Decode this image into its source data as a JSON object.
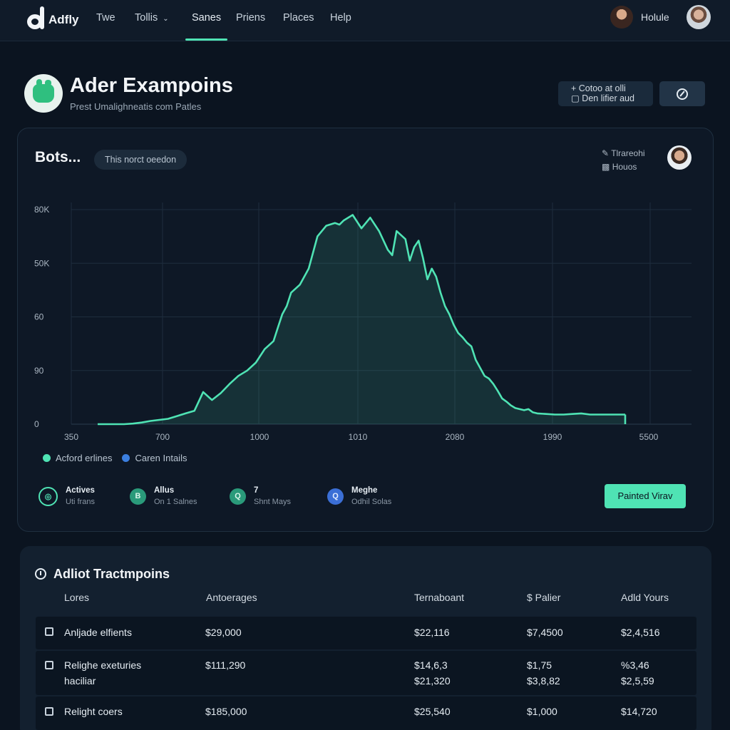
{
  "app": {
    "logo_text": "Adfly",
    "nav": [
      "Twe",
      "Tollis",
      "Sanes",
      "Priens",
      "Places",
      "Help"
    ],
    "user_name": "Holule"
  },
  "header": {
    "title": "Ader Exampoins",
    "subtitle": "Prest Umalighneatis com Patles",
    "stack_button": {
      "line1": "+ Cotoo at olli",
      "line2": "Den lifier aud"
    }
  },
  "chart_card": {
    "title": "Bots...",
    "chip": "This norct oeedon",
    "meta": [
      "Tlrareohi",
      "Houos"
    ],
    "legend": [
      {
        "label": "Acford erlines",
        "color": "#4fe3b4"
      },
      {
        "label": "Caren Intails",
        "color": "#3b7fe0"
      }
    ],
    "stats": [
      {
        "label": "Actives",
        "sub": "Uti frans",
        "icon": "◎",
        "color": "#4fe3b4"
      },
      {
        "label": "Allus",
        "sub": "On 1 Salnes",
        "icon": "B",
        "color": "#2a9a7a"
      },
      {
        "label": "7",
        "sub": "Shnt Mays",
        "icon": "Q",
        "color": "#2a9a7a"
      },
      {
        "label": "Meghe",
        "sub": "Odhil Solas",
        "icon": "Q",
        "color": "#3b6fd6"
      }
    ],
    "primary_button": "Painted Virav"
  },
  "chart_data": {
    "type": "area",
    "x_ticks": [
      "350",
      "700",
      "1000",
      "1010",
      "2080",
      "1990",
      "5500"
    ],
    "y_ticks": [
      "0",
      "90",
      "60",
      "50K",
      "80K"
    ],
    "y_tick_levels": [
      0,
      1,
      2,
      3,
      4
    ],
    "x": [
      0,
      0.1,
      0.2,
      0.3,
      0.4,
      0.5,
      0.6,
      0.7,
      0.8,
      0.9,
      1.0,
      1.1,
      1.2,
      1.3,
      1.4,
      1.5,
      1.6,
      1.7,
      1.8,
      1.9,
      2.0,
      2.05,
      2.1,
      2.15,
      2.2,
      2.3,
      2.4,
      2.5,
      2.6,
      2.7,
      2.75,
      2.8,
      2.9,
      3.0,
      3.1,
      3.2,
      3.3,
      3.35,
      3.4,
      3.5,
      3.55,
      3.6,
      3.65,
      3.7,
      3.75,
      3.8,
      3.85,
      3.9,
      3.95,
      4.0,
      4.05,
      4.1,
      4.15,
      4.2,
      4.25,
      4.3,
      4.35,
      4.4,
      4.45,
      4.5,
      4.55,
      4.6,
      4.65,
      4.7,
      4.75,
      4.8,
      4.85,
      4.9,
      4.95,
      5.0,
      5.1,
      5.2,
      5.3,
      5.4,
      5.5,
      5.6,
      5.7,
      5.8,
      5.9,
      6.0
    ],
    "y": [
      0,
      0,
      0,
      0,
      0.01,
      0.03,
      0.06,
      0.08,
      0.1,
      0.15,
      0.2,
      0.25,
      0.6,
      0.45,
      0.58,
      0.75,
      0.9,
      1.0,
      1.15,
      1.4,
      1.55,
      1.8,
      2.05,
      2.2,
      2.45,
      2.6,
      2.9,
      3.5,
      3.7,
      3.75,
      3.72,
      3.8,
      3.9,
      3.65,
      3.85,
      3.6,
      3.25,
      3.15,
      3.6,
      3.45,
      3.05,
      3.3,
      3.42,
      3.1,
      2.7,
      2.9,
      2.75,
      2.45,
      2.2,
      2.05,
      1.85,
      1.7,
      1.62,
      1.52,
      1.45,
      1.2,
      1.05,
      0.9,
      0.85,
      0.75,
      0.62,
      0.48,
      0.42,
      0.35,
      0.3,
      0.28,
      0.26,
      0.28,
      0.22,
      0.2,
      0.19,
      0.18,
      0.18,
      0.19,
      0.2,
      0.18,
      0.18,
      0.18,
      0.18,
      0.18
    ],
    "series": [
      {
        "name": "Acford erlines",
        "color": "#4fe3b4"
      }
    ],
    "grid": true
  },
  "table": {
    "title": "Adliot Tractmpoins",
    "headers": [
      "Lores",
      "Antoerages",
      "Ternaboant",
      "$ Palier",
      "Adld Yours"
    ],
    "rows": [
      {
        "cells": [
          [
            "Anljade elfients"
          ],
          [
            "$29,000"
          ],
          [
            "$22,116"
          ],
          [
            "$7,4500"
          ],
          [
            "$2,4,516"
          ]
        ]
      },
      {
        "cells": [
          [
            "Relighe exeturies",
            "haciliar"
          ],
          [
            "$111,290"
          ],
          [
            "$14,6,3",
            "$21,320"
          ],
          [
            "$1,75",
            "$3,8,82"
          ],
          [
            "%3,46",
            "$2,5,59"
          ]
        ]
      },
      {
        "cells": [
          [
            "Relight coers"
          ],
          [
            "$185,000"
          ],
          [
            "$25,540"
          ],
          [
            "$1,000"
          ],
          [
            "$14,720"
          ]
        ]
      }
    ]
  }
}
